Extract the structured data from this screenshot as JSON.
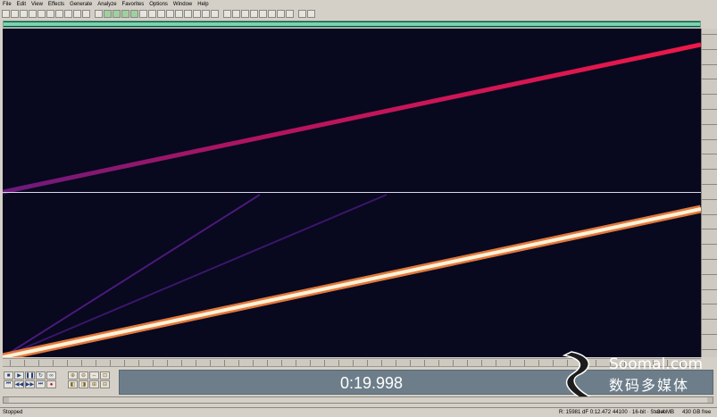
{
  "menu": [
    "File",
    "Edit",
    "View",
    "Effects",
    "Generate",
    "Analyze",
    "Favorites",
    "Options",
    "Window",
    "Help"
  ],
  "toolbar_buttons": 34,
  "transport_buttons": [
    "stop",
    "play",
    "pause",
    "play-looped",
    "loop",
    "go-to-start",
    "rewind",
    "fast-forward",
    "go-to-end",
    "record"
  ],
  "time_display": "0:19.998",
  "watermark": {
    "brand": "Soomal.com",
    "chinese": "数码多媒体"
  },
  "status": {
    "state": "Stopped",
    "left_info": "R: 15981 dF   0:12.472",
    "format": "44100 · 16-bit · Stereo",
    "size": "3.4 MB",
    "free": "430 GB free"
  },
  "colors": {
    "waveform_bg": "#08081f",
    "sweep_top": "#e0134c",
    "sweep_bottom": "#ffd9a0",
    "overview": "#7ad3b3"
  }
}
